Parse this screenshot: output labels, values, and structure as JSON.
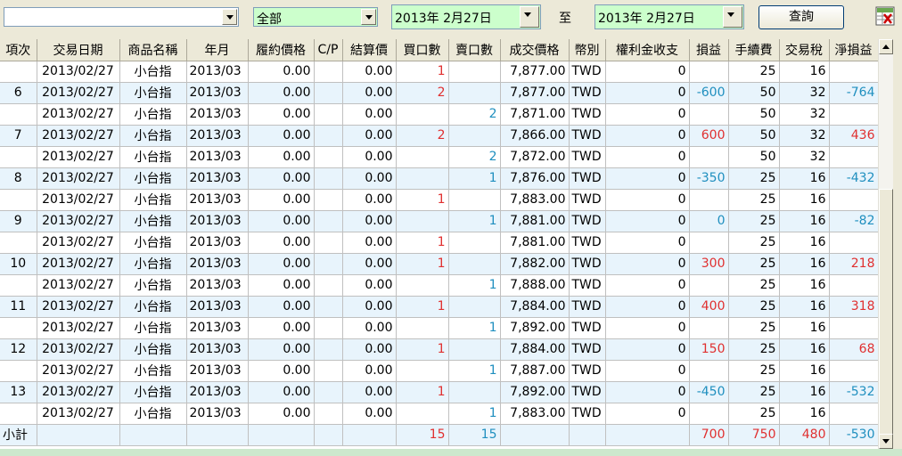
{
  "toolbar": {
    "account_value": "",
    "category_value": "全部",
    "start_date": "2013年  2月27日",
    "to_label": "至",
    "end_date": "2013年  2月27日",
    "query_label": "查詢",
    "export_icon": "excel-export-icon"
  },
  "table": {
    "columns": [
      "項次",
      "交易日期",
      "商品名稱",
      "年月",
      "履約價格",
      "C/P",
      "結算價",
      "買口數",
      "賣口數",
      "成交價格",
      "幣別",
      "權利金收支",
      "損益",
      "手續費",
      "交易稅",
      "淨損益"
    ],
    "rows": [
      {
        "no": "",
        "date": "2013/02/27",
        "product": "小台指",
        "ym": "2013/03",
        "strike": "0.00",
        "cp": "",
        "settle": "0.00",
        "buy": "1",
        "sell": "",
        "price": "7,877.00",
        "cur": "TWD",
        "premium": "0",
        "pnl": "",
        "pnl_color": "",
        "fee": "25",
        "tax": "16",
        "net": "",
        "net_color": ""
      },
      {
        "no": "6",
        "date": "2013/02/27",
        "product": "小台指",
        "ym": "2013/03",
        "strike": "0.00",
        "cp": "",
        "settle": "0.00",
        "buy": "2",
        "sell": "",
        "price": "7,877.00",
        "cur": "TWD",
        "premium": "0",
        "pnl": "-600",
        "pnl_color": "blue",
        "fee": "50",
        "tax": "32",
        "net": "-764",
        "net_color": "blue"
      },
      {
        "no": "",
        "date": "2013/02/27",
        "product": "小台指",
        "ym": "2013/03",
        "strike": "0.00",
        "cp": "",
        "settle": "0.00",
        "buy": "",
        "sell": "2",
        "price": "7,871.00",
        "cur": "TWD",
        "premium": "0",
        "pnl": "",
        "pnl_color": "",
        "fee": "50",
        "tax": "32",
        "net": "",
        "net_color": ""
      },
      {
        "no": "7",
        "date": "2013/02/27",
        "product": "小台指",
        "ym": "2013/03",
        "strike": "0.00",
        "cp": "",
        "settle": "0.00",
        "buy": "2",
        "sell": "",
        "price": "7,866.00",
        "cur": "TWD",
        "premium": "0",
        "pnl": "600",
        "pnl_color": "red",
        "fee": "50",
        "tax": "32",
        "net": "436",
        "net_color": "red"
      },
      {
        "no": "",
        "date": "2013/02/27",
        "product": "小台指",
        "ym": "2013/03",
        "strike": "0.00",
        "cp": "",
        "settle": "0.00",
        "buy": "",
        "sell": "2",
        "price": "7,872.00",
        "cur": "TWD",
        "premium": "0",
        "pnl": "",
        "pnl_color": "",
        "fee": "50",
        "tax": "32",
        "net": "",
        "net_color": ""
      },
      {
        "no": "8",
        "date": "2013/02/27",
        "product": "小台指",
        "ym": "2013/03",
        "strike": "0.00",
        "cp": "",
        "settle": "0.00",
        "buy": "",
        "sell": "1",
        "price": "7,876.00",
        "cur": "TWD",
        "premium": "0",
        "pnl": "-350",
        "pnl_color": "blue",
        "fee": "25",
        "tax": "16",
        "net": "-432",
        "net_color": "blue"
      },
      {
        "no": "",
        "date": "2013/02/27",
        "product": "小台指",
        "ym": "2013/03",
        "strike": "0.00",
        "cp": "",
        "settle": "0.00",
        "buy": "1",
        "sell": "",
        "price": "7,883.00",
        "cur": "TWD",
        "premium": "0",
        "pnl": "",
        "pnl_color": "",
        "fee": "25",
        "tax": "16",
        "net": "",
        "net_color": ""
      },
      {
        "no": "9",
        "date": "2013/02/27",
        "product": "小台指",
        "ym": "2013/03",
        "strike": "0.00",
        "cp": "",
        "settle": "0.00",
        "buy": "",
        "sell": "1",
        "price": "7,881.00",
        "cur": "TWD",
        "premium": "0",
        "pnl": "0",
        "pnl_color": "blue",
        "fee": "25",
        "tax": "16",
        "net": "-82",
        "net_color": "blue"
      },
      {
        "no": "",
        "date": "2013/02/27",
        "product": "小台指",
        "ym": "2013/03",
        "strike": "0.00",
        "cp": "",
        "settle": "0.00",
        "buy": "1",
        "sell": "",
        "price": "7,881.00",
        "cur": "TWD",
        "premium": "0",
        "pnl": "",
        "pnl_color": "",
        "fee": "25",
        "tax": "16",
        "net": "",
        "net_color": ""
      },
      {
        "no": "10",
        "date": "2013/02/27",
        "product": "小台指",
        "ym": "2013/03",
        "strike": "0.00",
        "cp": "",
        "settle": "0.00",
        "buy": "1",
        "sell": "",
        "price": "7,882.00",
        "cur": "TWD",
        "premium": "0",
        "pnl": "300",
        "pnl_color": "red",
        "fee": "25",
        "tax": "16",
        "net": "218",
        "net_color": "red"
      },
      {
        "no": "",
        "date": "2013/02/27",
        "product": "小台指",
        "ym": "2013/03",
        "strike": "0.00",
        "cp": "",
        "settle": "0.00",
        "buy": "",
        "sell": "1",
        "price": "7,888.00",
        "cur": "TWD",
        "premium": "0",
        "pnl": "",
        "pnl_color": "",
        "fee": "25",
        "tax": "16",
        "net": "",
        "net_color": ""
      },
      {
        "no": "11",
        "date": "2013/02/27",
        "product": "小台指",
        "ym": "2013/03",
        "strike": "0.00",
        "cp": "",
        "settle": "0.00",
        "buy": "1",
        "sell": "",
        "price": "7,884.00",
        "cur": "TWD",
        "premium": "0",
        "pnl": "400",
        "pnl_color": "red",
        "fee": "25",
        "tax": "16",
        "net": "318",
        "net_color": "red"
      },
      {
        "no": "",
        "date": "2013/02/27",
        "product": "小台指",
        "ym": "2013/03",
        "strike": "0.00",
        "cp": "",
        "settle": "0.00",
        "buy": "",
        "sell": "1",
        "price": "7,892.00",
        "cur": "TWD",
        "premium": "0",
        "pnl": "",
        "pnl_color": "",
        "fee": "25",
        "tax": "16",
        "net": "",
        "net_color": ""
      },
      {
        "no": "12",
        "date": "2013/02/27",
        "product": "小台指",
        "ym": "2013/03",
        "strike": "0.00",
        "cp": "",
        "settle": "0.00",
        "buy": "1",
        "sell": "",
        "price": "7,884.00",
        "cur": "TWD",
        "premium": "0",
        "pnl": "150",
        "pnl_color": "red",
        "fee": "25",
        "tax": "16",
        "net": "68",
        "net_color": "red"
      },
      {
        "no": "",
        "date": "2013/02/27",
        "product": "小台指",
        "ym": "2013/03",
        "strike": "0.00",
        "cp": "",
        "settle": "0.00",
        "buy": "",
        "sell": "1",
        "price": "7,887.00",
        "cur": "TWD",
        "premium": "0",
        "pnl": "",
        "pnl_color": "",
        "fee": "25",
        "tax": "16",
        "net": "",
        "net_color": ""
      },
      {
        "no": "13",
        "date": "2013/02/27",
        "product": "小台指",
        "ym": "2013/03",
        "strike": "0.00",
        "cp": "",
        "settle": "0.00",
        "buy": "1",
        "sell": "",
        "price": "7,892.00",
        "cur": "TWD",
        "premium": "0",
        "pnl": "-450",
        "pnl_color": "blue",
        "fee": "25",
        "tax": "16",
        "net": "-532",
        "net_color": "blue"
      },
      {
        "no": "",
        "date": "2013/02/27",
        "product": "小台指",
        "ym": "2013/03",
        "strike": "0.00",
        "cp": "",
        "settle": "0.00",
        "buy": "",
        "sell": "1",
        "price": "7,883.00",
        "cur": "TWD",
        "premium": "0",
        "pnl": "",
        "pnl_color": "",
        "fee": "25",
        "tax": "16",
        "net": "",
        "net_color": ""
      }
    ],
    "subtotal": {
      "label": "小計",
      "buy": "15",
      "sell": "15",
      "pnl": "700",
      "fee": "750",
      "tax": "480",
      "net": "-530",
      "pnl_color": "red",
      "fee_color": "red",
      "tax_color": "red",
      "net_color": "blue"
    }
  }
}
